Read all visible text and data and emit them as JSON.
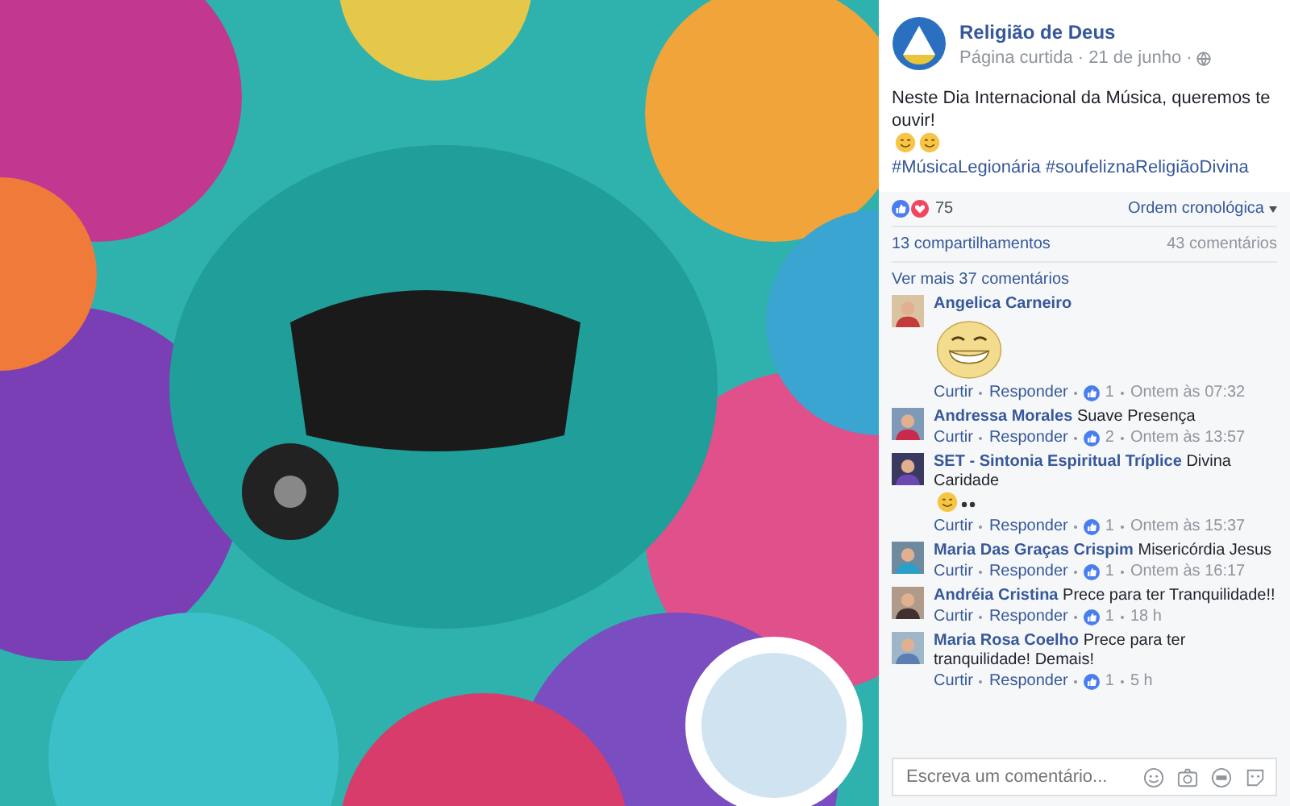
{
  "post": {
    "page_name": "Religião de Deus",
    "meta": "Página curtida · 21 de junho ·",
    "text": "Neste Dia Internacional da Música, queremos te ouvir!",
    "hashtags": [
      "#MúsicaLegionária",
      "#soufeliznaReligiãoDivina"
    ]
  },
  "reactions": {
    "count": "75",
    "sort": "Ordem cronológica"
  },
  "stats": {
    "shares": "13 compartilhamentos",
    "comments": "43 comentários"
  },
  "more_comments": "Ver mais 37 comentários",
  "comments": [
    {
      "kind": "sticker",
      "author": "Angelica Carneiro",
      "like": "Curtir",
      "reply": "Responder",
      "likes": "1",
      "time": "Ontem às 07:32"
    },
    {
      "kind": "text",
      "author": "Andressa Morales",
      "text": "Suave Presença",
      "trailing_emoji": false,
      "like": "Curtir",
      "reply": "Responder",
      "likes": "2",
      "time": "Ontem às 13:57"
    },
    {
      "kind": "text",
      "author": "SET - Sintonia Espiritual Tríplice",
      "text": "Divina Caridade",
      "trailing_emoji": true,
      "like": "Curtir",
      "reply": "Responder",
      "likes": "1",
      "time": "Ontem às 15:37"
    },
    {
      "kind": "text",
      "author": "Maria Das Graças Crispim",
      "text": "Misericórdia Jesus",
      "trailing_emoji": false,
      "like": "Curtir",
      "reply": "Responder",
      "likes": "1",
      "time": "Ontem às 16:17"
    },
    {
      "kind": "text",
      "author": "Andréia Cristina",
      "text": "Prece para ter Tranquilidade!!",
      "trailing_emoji": false,
      "like": "Curtir",
      "reply": "Responder",
      "likes": "1",
      "time": "18 h"
    },
    {
      "kind": "text",
      "author": "Maria Rosa Coelho",
      "text": "Prece para ter tranquilidade! Demais!",
      "trailing_emoji": false,
      "like": "Curtir",
      "reply": "Responder",
      "likes": "1",
      "time": "5 h"
    }
  ],
  "composer": {
    "placeholder": "Escreva um comentário..."
  }
}
